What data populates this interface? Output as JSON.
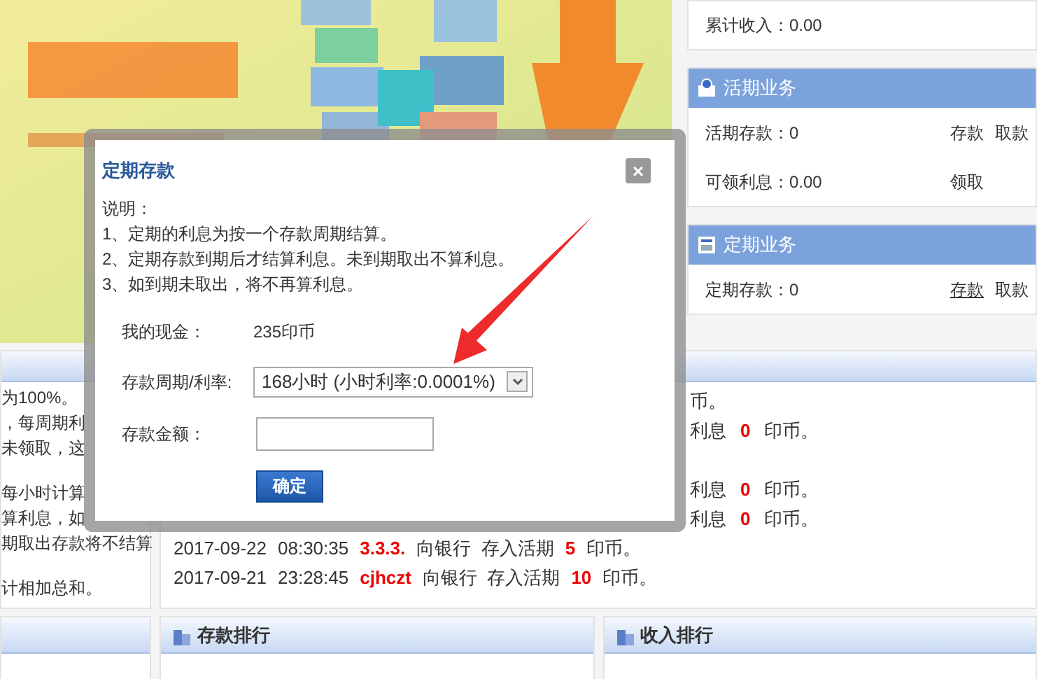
{
  "income_card": {
    "label": "累计收入：",
    "value": "0.00"
  },
  "current_business": {
    "title": "活期业务",
    "rows": [
      {
        "label": "活期存款：",
        "value": "0",
        "links": [
          {
            "label": "存款",
            "hovered": false
          },
          {
            "label": "取款",
            "hovered": false
          }
        ]
      },
      {
        "label": "可领利息：",
        "value": "0.00",
        "links": [
          {
            "label": "领取",
            "hovered": false
          }
        ]
      }
    ]
  },
  "fixed_business": {
    "title": "定期业务",
    "rows": [
      {
        "label": "定期存款：",
        "value": "0",
        "links": [
          {
            "label": "存款",
            "hovered": true
          },
          {
            "label": "取款",
            "hovered": false
          }
        ]
      }
    ]
  },
  "rules_panel": {
    "lines": [
      {
        "kind": "text",
        "text": "为100%。"
      },
      {
        "kind": "text",
        "text": "，每周期利"
      },
      {
        "kind": "text",
        "text": "未领取，这"
      },
      {
        "kind": "gap"
      },
      {
        "kind": "text",
        "text": "每小时计算"
      },
      {
        "kind": "text",
        "text": "算利息，如"
      },
      {
        "kind": "text",
        "text": "期取出存款将不结算"
      },
      {
        "kind": "gap"
      },
      {
        "kind": "text",
        "text": "计相加总和。"
      }
    ]
  },
  "log_panel": {
    "entries": [
      {
        "kind": "partial",
        "text": "币。"
      },
      {
        "kind": "partial",
        "text": "利息",
        "amount": "0",
        "unit": "印币。"
      },
      {
        "kind": "gap"
      },
      {
        "kind": "partial",
        "text": "利息",
        "amount": "0",
        "unit": "印币。"
      },
      {
        "kind": "partial",
        "text": "利息",
        "amount": "0",
        "unit": "印币。"
      },
      {
        "kind": "full",
        "date": "2017-09-22",
        "time": "08:30:35",
        "user": "3.3.3.",
        "action": "向银行  存入活期",
        "amount": "5",
        "unit": "印币。"
      },
      {
        "kind": "full",
        "date": "2017-09-21",
        "time": "23:28:45",
        "user": "cjhczt",
        "action": "向银行  存入活期",
        "amount": "10",
        "unit": "印币。"
      }
    ]
  },
  "bottom_panels": [
    {
      "title": "存款排行"
    },
    {
      "title": "收入排行"
    }
  ],
  "dialog": {
    "title": "定期存款",
    "close": "×",
    "notes_title": "说明：",
    "notes": [
      "1、定期的利息为按一个存款周期结算。",
      "2、定期存款到期后才结算利息。未到期取出不算利息。",
      "3、如到期未取出，将不再算利息。"
    ],
    "cash_label": "我的现金：",
    "cash_value": "235印币",
    "period_label": "存款周期/利率:",
    "period_value": "168小时 (小时利率:0.0001%)",
    "amount_label": "存款金额：",
    "confirm": "确定"
  }
}
